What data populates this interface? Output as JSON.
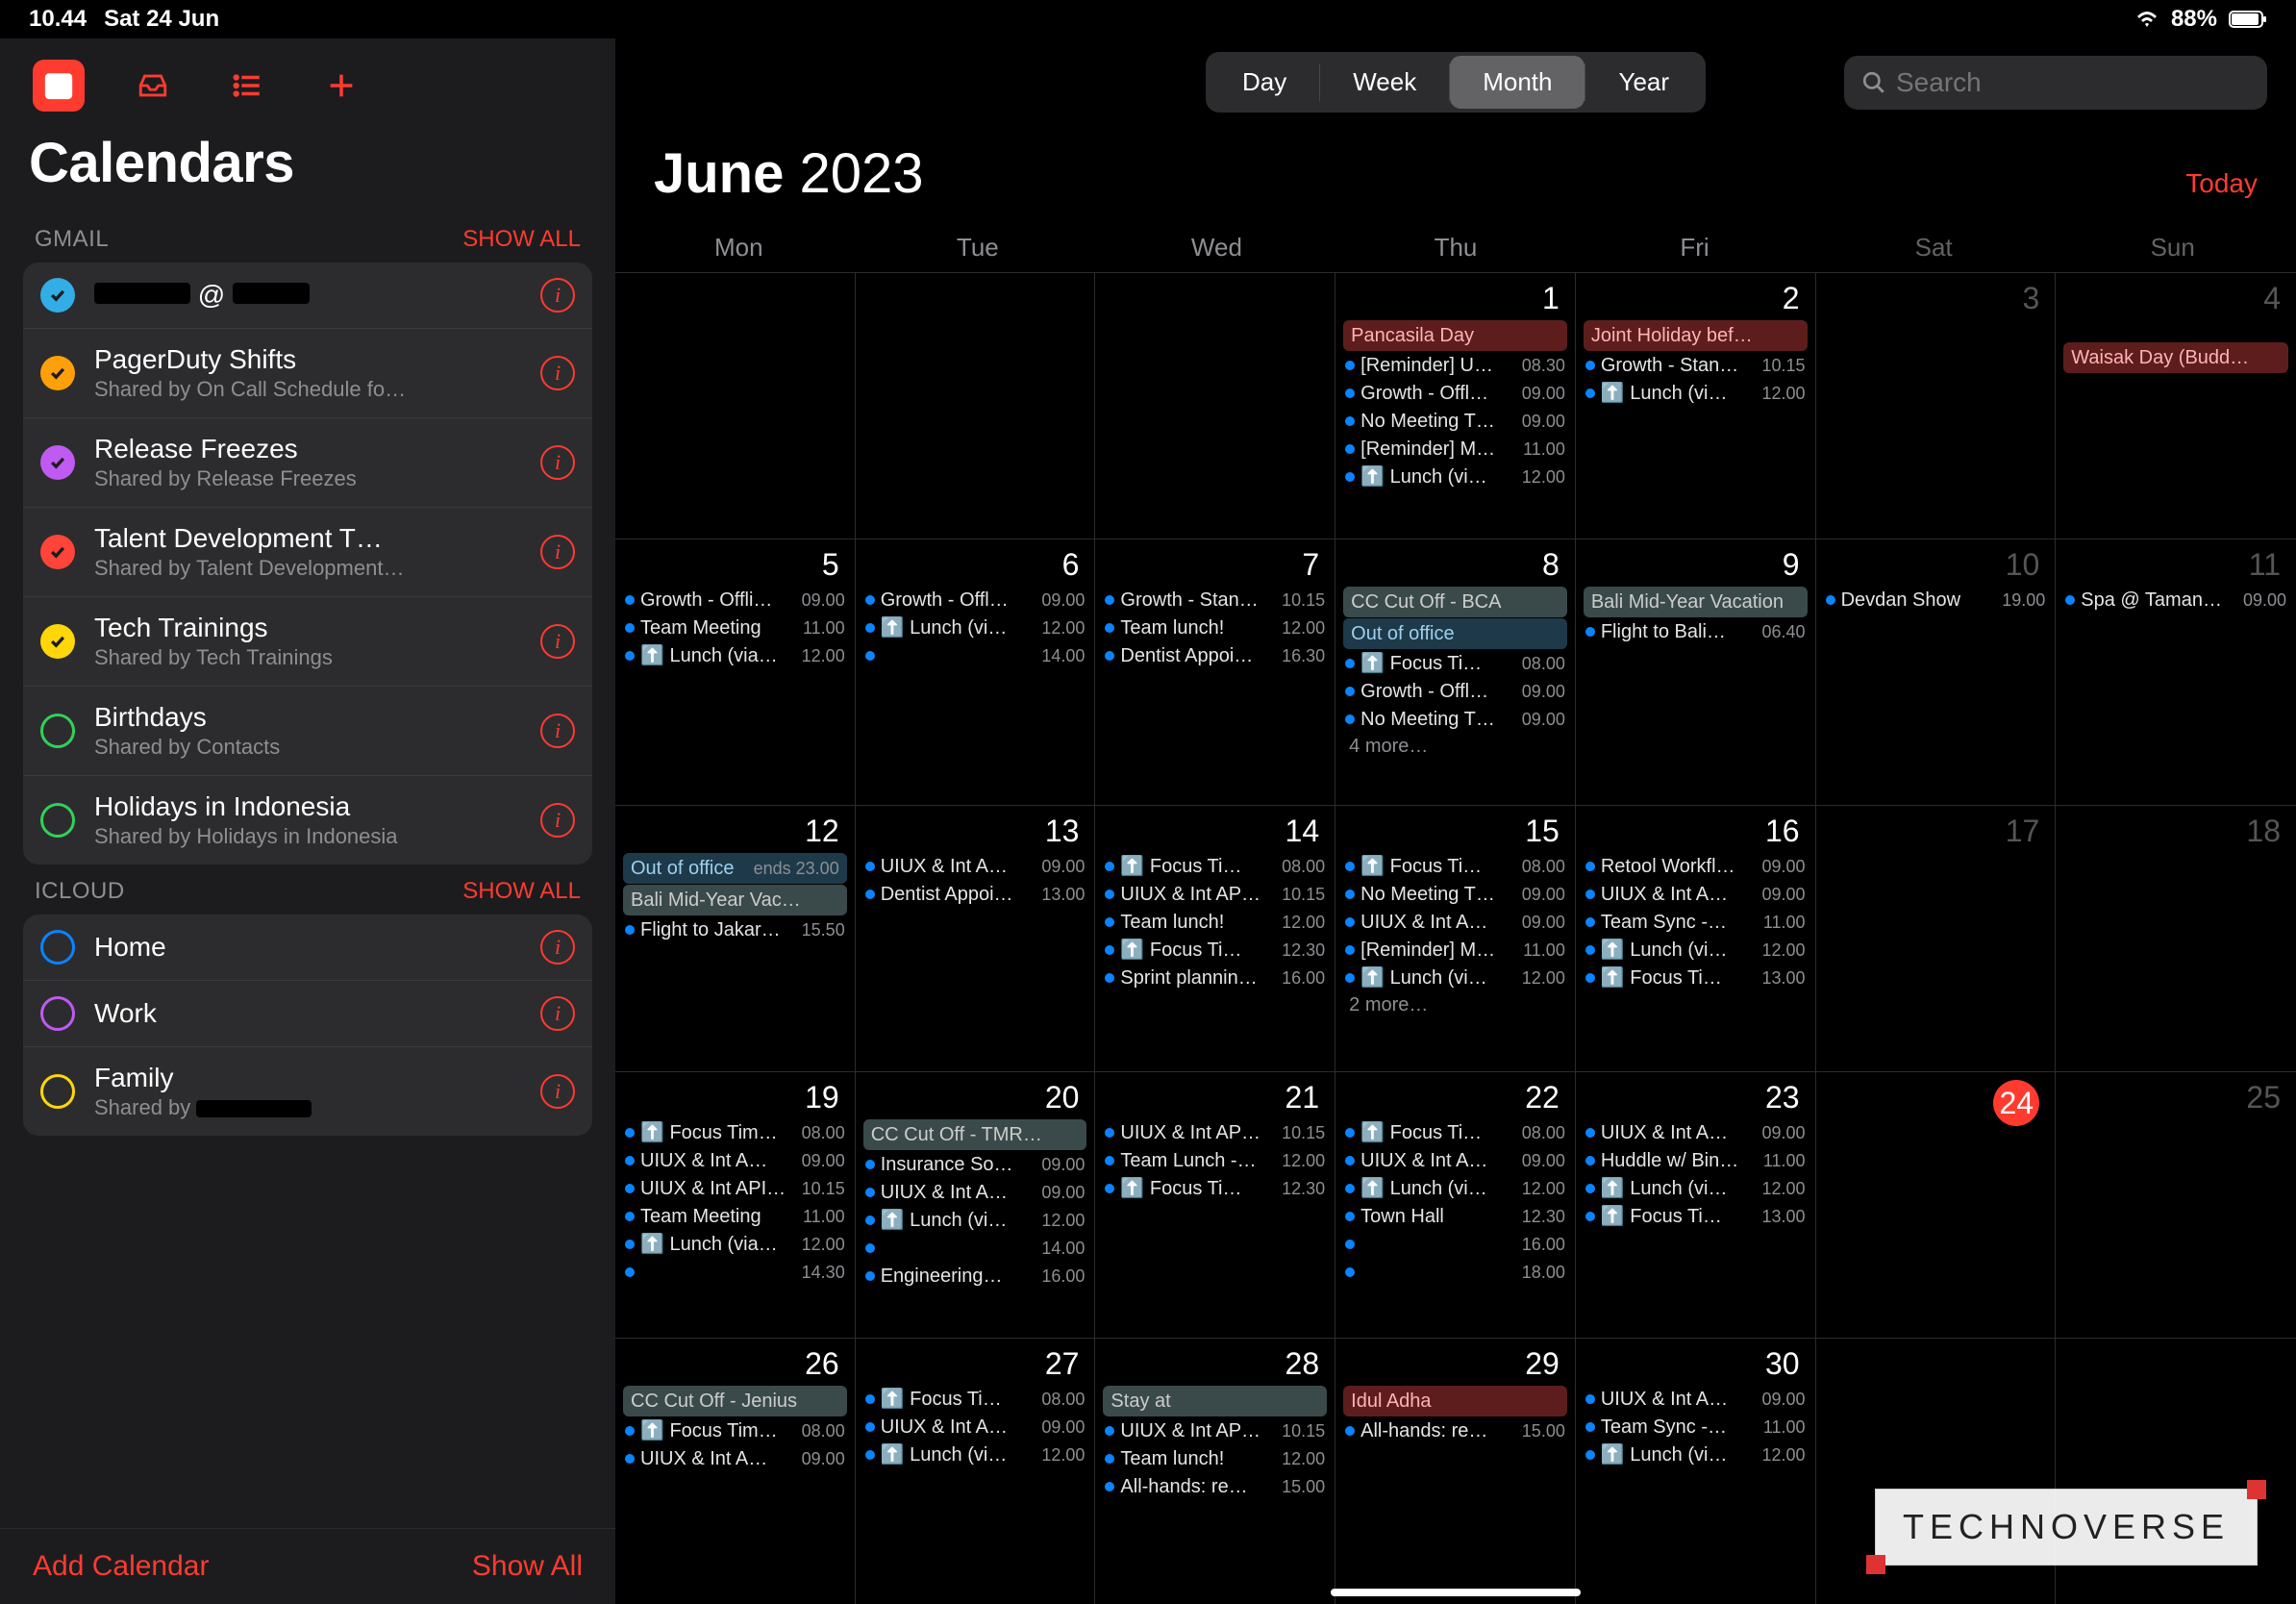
{
  "status": {
    "time": "10.44",
    "date": "Sat 24 Jun",
    "battery_pct": "88%"
  },
  "sidebar": {
    "title": "Calendars",
    "add_calendar": "Add Calendar",
    "show_all_bottom": "Show All",
    "accounts": [
      {
        "name": "GMAIL",
        "show_all": "SHOW ALL",
        "items": [
          {
            "title": "",
            "sub": "",
            "color": "#32ade6",
            "checked": true,
            "redact_title": true
          },
          {
            "title": "PagerDuty Shifts",
            "sub": "Shared by On Call Schedule fo…",
            "color": "#ff9f0a",
            "checked": true
          },
          {
            "title": "Release Freezes",
            "sub": "Shared by Release Freezes",
            "color": "#bf5af2",
            "checked": true
          },
          {
            "title": "Talent Development T…",
            "sub": "Shared by Talent Development…",
            "color": "#ff453a",
            "checked": true
          },
          {
            "title": "Tech Trainings",
            "sub": "Shared by Tech Trainings",
            "color": "#ffd60a",
            "checked": true
          },
          {
            "title": "Birthdays",
            "sub": "Shared by Contacts",
            "color": "#30d158",
            "checked": false
          },
          {
            "title": "Holidays in Indonesia",
            "sub": "Shared by Holidays in Indonesia",
            "color": "#30d158",
            "checked": false
          }
        ]
      },
      {
        "name": "ICLOUD",
        "show_all": "SHOW ALL",
        "items": [
          {
            "title": "Home",
            "sub": "",
            "color": "#0a84ff",
            "checked": false
          },
          {
            "title": "Work",
            "sub": "",
            "color": "#bf5af2",
            "checked": false
          },
          {
            "title": "Family",
            "sub": "Shared by",
            "color": "#ffd60a",
            "checked": false,
            "redact_sub": true
          }
        ]
      }
    ]
  },
  "segments": [
    "Day",
    "Week",
    "Month",
    "Year"
  ],
  "segment_active": 2,
  "search_placeholder": "Search",
  "month": "June",
  "year": "2023",
  "today_label": "Today",
  "weekdays": [
    "Mon",
    "Tue",
    "Wed",
    "Thu",
    "Fri",
    "Sat",
    "Sun"
  ],
  "colors": {
    "blue": "#0a84ff",
    "cyan": "#64d2ff"
  },
  "weeks": [
    [
      {
        "num": "",
        "events": []
      },
      {
        "num": "",
        "events": []
      },
      {
        "num": "",
        "events": []
      },
      {
        "num": "1",
        "events": [
          {
            "type": "bar",
            "style": "holiday",
            "label": "Pancasila Day"
          },
          {
            "type": "row",
            "dot": "#0a84ff",
            "label": "[Reminder] U…",
            "time": "08.30"
          },
          {
            "type": "row",
            "dot": "#0a84ff",
            "label": "Growth - Offl…",
            "time": "09.00"
          },
          {
            "type": "row",
            "dot": "#0a84ff",
            "label": "No Meeting T…",
            "time": "09.00"
          },
          {
            "type": "row",
            "dot": "#0a84ff",
            "label": "[Reminder] M…",
            "time": "11.00"
          },
          {
            "type": "row",
            "dot": "#0a84ff",
            "label": "⬆️ Lunch (vi…",
            "time": "12.00"
          }
        ]
      },
      {
        "num": "2",
        "events": [
          {
            "type": "bar",
            "style": "holiday",
            "label": "Joint Holiday bef…"
          },
          {
            "type": "row",
            "dot": "#0a84ff",
            "label": "Growth - Stan…",
            "time": "10.15"
          },
          {
            "type": "row",
            "dot": "#0a84ff",
            "label": "⬆️ Lunch (vi…",
            "time": "12.00"
          }
        ]
      },
      {
        "num": "3",
        "dim": true,
        "events": []
      },
      {
        "num": "4",
        "dim": true,
        "events": [
          {
            "type": "redact"
          },
          {
            "type": "bar",
            "style": "holiday",
            "label": "Waisak Day (Budd…"
          }
        ]
      }
    ],
    [
      {
        "num": "5",
        "events": [
          {
            "type": "row",
            "dot": "#0a84ff",
            "label": "Growth - Offli…",
            "time": "09.00"
          },
          {
            "type": "row",
            "dot": "#0a84ff",
            "label": "Team Meeting",
            "time": "11.00"
          },
          {
            "type": "row",
            "dot": "#0a84ff",
            "label": "⬆️ Lunch (via…",
            "time": "12.00"
          }
        ]
      },
      {
        "num": "6",
        "events": [
          {
            "type": "row",
            "dot": "#0a84ff",
            "label": "Growth - Offl…",
            "time": "09.00"
          },
          {
            "type": "row",
            "dot": "#0a84ff",
            "label": "⬆️ Lunch (vi…",
            "time": "12.00"
          },
          {
            "type": "row",
            "dot": "#0a84ff",
            "label": "",
            "time": "14.00"
          }
        ]
      },
      {
        "num": "7",
        "events": [
          {
            "type": "row",
            "dot": "#0a84ff",
            "label": "Growth - Stan…",
            "time": "10.15"
          },
          {
            "type": "row",
            "dot": "#0a84ff",
            "label": "Team lunch!",
            "time": "12.00"
          },
          {
            "type": "row",
            "dot": "#0a84ff",
            "label": "Dentist Appoi…",
            "time": "16.30"
          }
        ]
      },
      {
        "num": "8",
        "events": [
          {
            "type": "bar",
            "style": "ccut",
            "label": "CC Cut Off - BCA"
          },
          {
            "type": "bar",
            "style": "ooo",
            "label": "Out of office"
          },
          {
            "type": "row",
            "dot": "#0a84ff",
            "label": "⬆️ Focus Ti…",
            "time": "08.00"
          },
          {
            "type": "row",
            "dot": "#0a84ff",
            "label": "Growth - Offl…",
            "time": "09.00"
          },
          {
            "type": "row",
            "dot": "#0a84ff",
            "label": "No Meeting T…",
            "time": "09.00"
          },
          {
            "type": "more",
            "label": "4 more…"
          }
        ]
      },
      {
        "num": "9",
        "span_bar": {
          "style": "vac",
          "label": "Bali Mid-Year Vacation",
          "cols": 3
        },
        "events": [
          {
            "type": "row",
            "dot": "#0a84ff",
            "label": "Flight to Bali…",
            "time": "06.40"
          }
        ]
      },
      {
        "num": "10",
        "dim": true,
        "events": [
          {
            "type": "row",
            "dot": "#0a84ff",
            "label": "Devdan Show",
            "time": "19.00"
          }
        ]
      },
      {
        "num": "11",
        "dim": true,
        "events": [
          {
            "type": "row",
            "dot": "#0a84ff",
            "label": "Spa @ Taman…",
            "time": "09.00"
          }
        ]
      }
    ],
    [
      {
        "num": "12",
        "span_bar": {
          "style": "ooo",
          "label": "Out of office",
          "cols": 2,
          "sub": "ends 23.00"
        },
        "span_bar2": {
          "style": "vac",
          "label": "Bali Mid-Year Vac…",
          "cols": 1
        },
        "events": [
          {
            "type": "row",
            "dot": "#0a84ff",
            "label": "Flight to Jakar…",
            "time": "15.50"
          }
        ]
      },
      {
        "num": "13",
        "events": [
          {
            "type": "row",
            "dot": "#0a84ff",
            "label": "UIUX & Int A…",
            "time": "09.00"
          },
          {
            "type": "row",
            "dot": "#0a84ff",
            "label": "Dentist Appoi…",
            "time": "13.00"
          }
        ]
      },
      {
        "num": "14",
        "events": [
          {
            "type": "row",
            "dot": "#0a84ff",
            "label": "⬆️ Focus Ti…",
            "time": "08.00"
          },
          {
            "type": "row",
            "dot": "#0a84ff",
            "label": "UIUX & Int AP…",
            "time": "10.15"
          },
          {
            "type": "row",
            "dot": "#0a84ff",
            "label": "Team lunch!",
            "time": "12.00"
          },
          {
            "type": "row",
            "dot": "#0a84ff",
            "label": "⬆️ Focus Ti…",
            "time": "12.30"
          },
          {
            "type": "row",
            "dot": "#0a84ff",
            "label": "Sprint plannin…",
            "time": "16.00"
          }
        ]
      },
      {
        "num": "15",
        "events": [
          {
            "type": "row",
            "dot": "#0a84ff",
            "label": "⬆️ Focus Ti…",
            "time": "08.00"
          },
          {
            "type": "row",
            "dot": "#0a84ff",
            "label": "No Meeting T…",
            "time": "09.00"
          },
          {
            "type": "row",
            "dot": "#0a84ff",
            "label": "UIUX & Int A…",
            "time": "09.00"
          },
          {
            "type": "row",
            "dot": "#0a84ff",
            "label": "[Reminder] M…",
            "time": "11.00"
          },
          {
            "type": "row",
            "dot": "#0a84ff",
            "label": "⬆️ Lunch (vi…",
            "time": "12.00"
          },
          {
            "type": "more",
            "label": "2 more…"
          }
        ]
      },
      {
        "num": "16",
        "events": [
          {
            "type": "row",
            "dot": "#0a84ff",
            "label": "Retool Workfl…",
            "time": "09.00"
          },
          {
            "type": "row",
            "dot": "#0a84ff",
            "label": "UIUX & Int A…",
            "time": "09.00"
          },
          {
            "type": "row",
            "dot": "#0a84ff",
            "label": "Team Sync -…",
            "time": "11.00"
          },
          {
            "type": "row",
            "dot": "#0a84ff",
            "label": "⬆️ Lunch (vi…",
            "time": "12.00"
          },
          {
            "type": "row",
            "dot": "#0a84ff",
            "label": "⬆️ Focus Ti…",
            "time": "13.00"
          }
        ]
      },
      {
        "num": "17",
        "dim": true,
        "events": []
      },
      {
        "num": "18",
        "dim": true,
        "events": []
      }
    ],
    [
      {
        "num": "19",
        "events": [
          {
            "type": "row",
            "dot": "#0a84ff",
            "label": "⬆️ Focus Tim…",
            "time": "08.00"
          },
          {
            "type": "row",
            "dot": "#0a84ff",
            "label": "UIUX & Int A…",
            "time": "09.00"
          },
          {
            "type": "row",
            "dot": "#0a84ff",
            "label": "UIUX & Int API…",
            "time": "10.15"
          },
          {
            "type": "row",
            "dot": "#0a84ff",
            "label": "Team Meeting",
            "time": "11.00"
          },
          {
            "type": "row",
            "dot": "#0a84ff",
            "label": "⬆️ Lunch (via…",
            "time": "12.00"
          },
          {
            "type": "row",
            "dot": "#0a84ff",
            "label": "",
            "time": "14.30"
          }
        ]
      },
      {
        "num": "20",
        "events": [
          {
            "type": "bar",
            "style": "ccut",
            "label": "CC Cut Off - TMR…"
          },
          {
            "type": "row",
            "dot": "#0a84ff",
            "label": "Insurance So…",
            "time": "09.00"
          },
          {
            "type": "row",
            "dot": "#0a84ff",
            "label": "UIUX & Int A…",
            "time": "09.00"
          },
          {
            "type": "row",
            "dot": "#0a84ff",
            "label": "⬆️ Lunch (vi…",
            "time": "12.00"
          },
          {
            "type": "row",
            "dot": "#0a84ff",
            "label": "",
            "time": "14.00"
          },
          {
            "type": "row",
            "dot": "#0a84ff",
            "label": "Engineering…",
            "time": "16.00"
          }
        ]
      },
      {
        "num": "21",
        "events": [
          {
            "type": "row",
            "dot": "#0a84ff",
            "label": "UIUX & Int AP…",
            "time": "10.15"
          },
          {
            "type": "row",
            "dot": "#0a84ff",
            "label": "Team Lunch -…",
            "time": "12.00"
          },
          {
            "type": "row",
            "dot": "#0a84ff",
            "label": "⬆️ Focus Ti…",
            "time": "12.30"
          }
        ]
      },
      {
        "num": "22",
        "events": [
          {
            "type": "row",
            "dot": "#0a84ff",
            "label": "⬆️ Focus Ti…",
            "time": "08.00"
          },
          {
            "type": "row",
            "dot": "#0a84ff",
            "label": "UIUX & Int A…",
            "time": "09.00"
          },
          {
            "type": "row",
            "dot": "#0a84ff",
            "label": "⬆️ Lunch (vi…",
            "time": "12.00"
          },
          {
            "type": "row",
            "dot": "#0a84ff",
            "label": "Town Hall",
            "time": "12.30"
          },
          {
            "type": "row",
            "dot": "#0a84ff",
            "label": "",
            "time": "16.00"
          },
          {
            "type": "row",
            "dot": "#0a84ff",
            "label": "",
            "time": "18.00"
          }
        ]
      },
      {
        "num": "23",
        "events": [
          {
            "type": "row",
            "dot": "#0a84ff",
            "label": "UIUX & Int A…",
            "time": "09.00"
          },
          {
            "type": "row",
            "dot": "#0a84ff",
            "label": "Huddle w/ Bin…",
            "time": "11.00"
          },
          {
            "type": "row",
            "dot": "#0a84ff",
            "label": "⬆️ Lunch (vi…",
            "time": "12.00"
          },
          {
            "type": "row",
            "dot": "#0a84ff",
            "label": "⬆️ Focus Ti…",
            "time": "13.00"
          }
        ]
      },
      {
        "num": "24",
        "dim": false,
        "today": true,
        "events": []
      },
      {
        "num": "25",
        "dim": true,
        "events": []
      }
    ],
    [
      {
        "num": "26",
        "events": [
          {
            "type": "bar",
            "style": "ccut",
            "label": "CC Cut Off - Jenius"
          },
          {
            "type": "row",
            "dot": "#0a84ff",
            "label": "⬆️ Focus Tim…",
            "time": "08.00"
          },
          {
            "type": "row",
            "dot": "#0a84ff",
            "label": "UIUX & Int A…",
            "time": "09.00"
          }
        ]
      },
      {
        "num": "27",
        "events": [
          {
            "type": "row",
            "dot": "#0a84ff",
            "label": "⬆️ Focus Ti…",
            "time": "08.00"
          },
          {
            "type": "row",
            "dot": "#0a84ff",
            "label": "UIUX & Int A…",
            "time": "09.00"
          },
          {
            "type": "row",
            "dot": "#0a84ff",
            "label": "⬆️ Lunch (vi…",
            "time": "12.00"
          }
        ]
      },
      {
        "num": "28",
        "events": [
          {
            "type": "bar",
            "style": "stay",
            "label": "Stay at"
          },
          {
            "type": "row",
            "dot": "#0a84ff",
            "label": "UIUX & Int AP…",
            "time": "10.15"
          },
          {
            "type": "row",
            "dot": "#0a84ff",
            "label": "Team lunch!",
            "time": "12.00"
          },
          {
            "type": "row",
            "dot": "#0a84ff",
            "label": "All-hands: re…",
            "time": "15.00"
          }
        ]
      },
      {
        "num": "29",
        "events": [
          {
            "type": "bar",
            "style": "holiday",
            "label": "Idul Adha"
          },
          {
            "type": "row",
            "dot": "#0a84ff",
            "label": "All-hands: re…",
            "time": "15.00"
          }
        ]
      },
      {
        "num": "30",
        "events": [
          {
            "type": "row",
            "dot": "#0a84ff",
            "label": "UIUX & Int A…",
            "time": "09.00"
          },
          {
            "type": "row",
            "dot": "#0a84ff",
            "label": "Team Sync -…",
            "time": "11.00"
          },
          {
            "type": "row",
            "dot": "#0a84ff",
            "label": "⬆️ Lunch (vi…",
            "time": "12.00"
          }
        ]
      },
      {
        "num": "",
        "events": []
      },
      {
        "num": "",
        "events": []
      }
    ]
  ],
  "watermark": "TECHNOVERSE"
}
